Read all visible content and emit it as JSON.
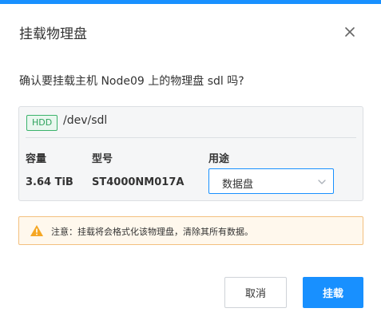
{
  "dialog": {
    "title": "挂载物理盘",
    "confirm_text": "确认要挂载主机 Node09 上的物理盘 sdl 吗?"
  },
  "disk": {
    "badge": "HDD",
    "path": "/dev/sdl",
    "columns": {
      "capacity_label": "容量",
      "model_label": "型号",
      "usage_label": "用途"
    },
    "capacity": "3.64 TiB",
    "model": "ST4000NM017A",
    "usage_selected": "数据盘"
  },
  "warning": {
    "text": "注意：挂载将会格式化该物理盘，清除其所有数据。"
  },
  "buttons": {
    "cancel": "取消",
    "mount": "挂载"
  },
  "icons": {
    "close": "close-icon",
    "warning": "warning-icon",
    "chevron": "chevron-down-icon"
  },
  "colors": {
    "accent": "#1890ff",
    "hdd_badge": "#2ea35d",
    "warning_border": "#f3c07f",
    "warning_icon": "#f5a623"
  }
}
